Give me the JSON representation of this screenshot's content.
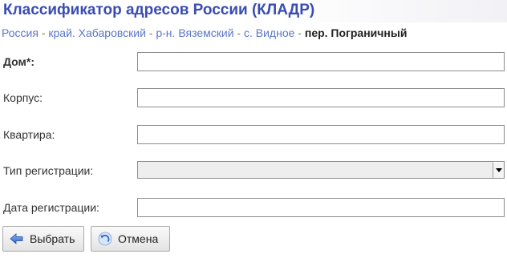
{
  "header": {
    "title": "Классификатор адресов России (КЛАДР)"
  },
  "breadcrumb": {
    "items": [
      "Россия",
      "край. Хабаровский",
      "р-н. Вяземский",
      "с. Видное"
    ],
    "separator": "-",
    "current": "пер. Пограничный"
  },
  "form": {
    "house_label": "Дом*:",
    "house_value": "",
    "building_label": "Корпус:",
    "building_value": "",
    "apartment_label": "Квартира:",
    "apartment_value": "",
    "reg_type_label": "Тип регистрации:",
    "reg_type_value": "",
    "reg_date_label": "Дата регистрации:",
    "reg_date_value": ""
  },
  "buttons": {
    "select_label": "Выбрать",
    "cancel_label": "Отмена"
  },
  "icons": {
    "select": "arrow-left-icon",
    "cancel": "undo-icon"
  },
  "colors": {
    "title": "#3a4cb2",
    "link": "#5a76c8"
  }
}
